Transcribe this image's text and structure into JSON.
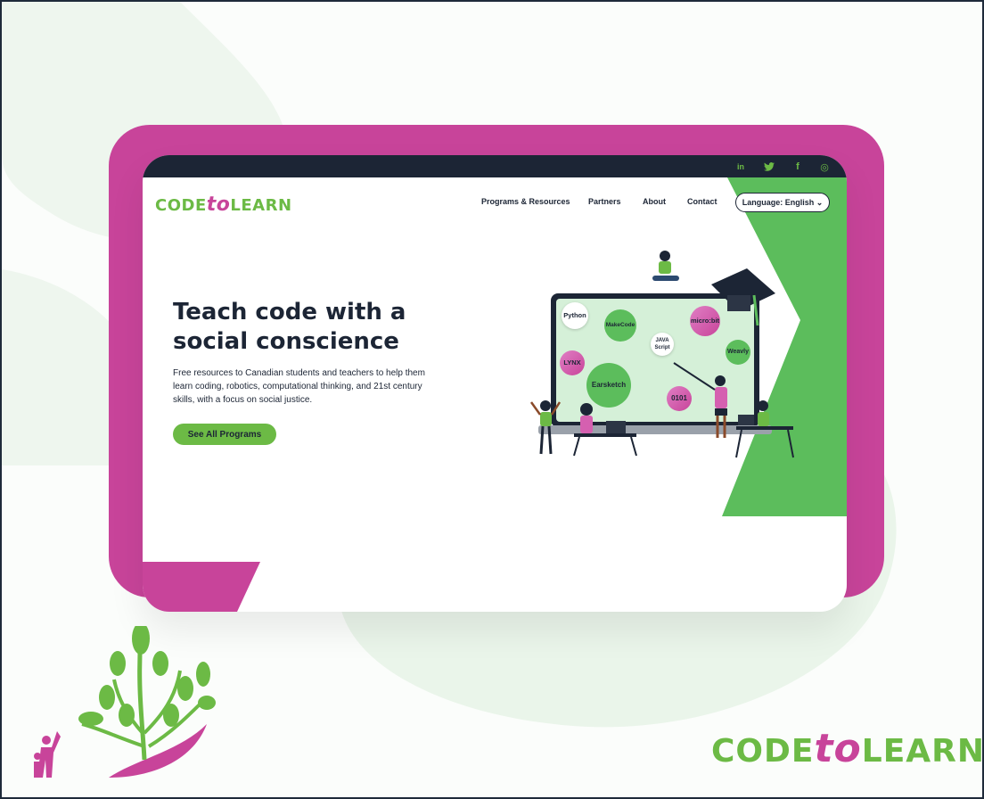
{
  "colors": {
    "pink": "#c8449a",
    "green": "#6cba45",
    "navy": "#1c2535"
  },
  "social": [
    {
      "icon": "linkedin-icon",
      "glyph": "in"
    },
    {
      "icon": "twitter-icon",
      "glyph": "🐦"
    },
    {
      "icon": "facebook-icon",
      "glyph": "f"
    },
    {
      "icon": "instagram-icon",
      "glyph": "◎"
    }
  ],
  "logo": {
    "part1": "CODE",
    "part2": "to",
    "part3": "LEARN"
  },
  "nav": {
    "programs": "Programs & Resources",
    "partners": "Partners",
    "about": "About",
    "contact": "Contact",
    "language": "Language: English ⌄"
  },
  "hero": {
    "title": "Teach code with a social conscience",
    "subtitle": "Free resources to Canadian students and teachers to help them learn coding, robotics, computational thinking, and 21st century skills, with a focus on social justice.",
    "cta": "See All Programs"
  },
  "bubbles": {
    "python": "Python",
    "makecode": "MakeCode",
    "microbit": "micro:bit",
    "java": "JAVA Script",
    "weavly": "Weavly",
    "lynx": "LYNX",
    "earsketch": "Earsketch",
    "binary": "0101"
  },
  "brand": {
    "part1": "CODE",
    "part2": "to",
    "part3": "LEARN"
  }
}
